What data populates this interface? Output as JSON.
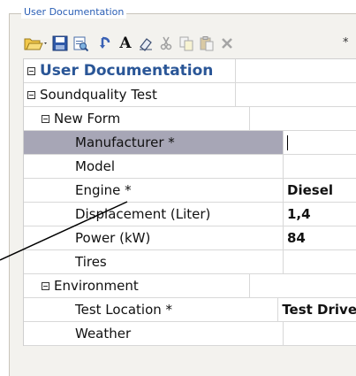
{
  "groupbox": {
    "title": "User Documentation"
  },
  "toolbar": {
    "buttons": [
      {
        "name": "open-dropdown-button",
        "icon": "folder-open-icon"
      },
      {
        "name": "save-button",
        "icon": "floppy-disk-icon"
      },
      {
        "name": "print-preview-button",
        "icon": "print-preview-icon"
      },
      {
        "name": "undo-button",
        "icon": "undo-arrow-icon"
      },
      {
        "name": "font-button",
        "icon": "font-a-icon",
        "text": "A"
      },
      {
        "name": "eraser-button",
        "icon": "eraser-icon"
      },
      {
        "name": "cut-button",
        "icon": "scissors-icon"
      },
      {
        "name": "copy-button",
        "icon": "copy-icon"
      },
      {
        "name": "paste-button",
        "icon": "paste-icon"
      },
      {
        "name": "delete-button",
        "icon": "delete-x-icon"
      }
    ],
    "star": "*"
  },
  "grid": {
    "root": {
      "label": "User Documentation"
    },
    "section1": {
      "label": "Soundquality Test"
    },
    "form": {
      "label": "New Form"
    },
    "rows": [
      {
        "label": "Manufacturer *",
        "value": ""
      },
      {
        "label": "Model",
        "value": ""
      },
      {
        "label": "Engine *",
        "value": "Diesel"
      },
      {
        "label": "Displacement (Liter)",
        "value": "1,4"
      },
      {
        "label": "Power (kW)",
        "value": "84"
      },
      {
        "label": "Tires",
        "value": ""
      }
    ],
    "section2": {
      "label": "Environment"
    },
    "env_rows": [
      {
        "label": "Test Location *",
        "value": "Test Drive"
      },
      {
        "label": "Weather",
        "value": ""
      }
    ]
  },
  "colors": {
    "selected_row": "#a7a6b6",
    "header_text": "#2a5697",
    "legend_text": "#2b5fb5"
  }
}
